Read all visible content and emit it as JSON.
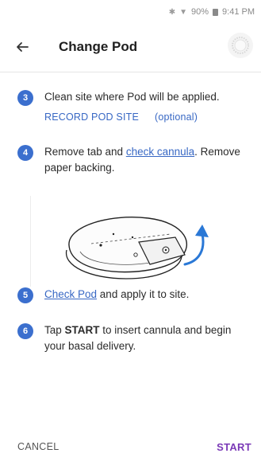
{
  "status_bar": {
    "battery": "90%",
    "time": "9:41 PM",
    "icons": [
      "bluetooth-icon",
      "wifi-icon",
      "battery-icon"
    ]
  },
  "header": {
    "title": "Change Pod",
    "back_icon": "arrow-left-icon",
    "status_icon": "pod-status-icon"
  },
  "steps": [
    {
      "number": "3",
      "text": "Clean site where Pod will be applied.",
      "record_label": "RECORD POD SITE",
      "optional_label": "(optional)"
    },
    {
      "number": "4",
      "pre": "Remove tab and ",
      "link": "check cannula",
      "post": ". Remove paper backing."
    },
    {
      "number": "5",
      "link": "Check Pod",
      "post": " and apply it to site."
    },
    {
      "number": "6",
      "pre": "Tap ",
      "bold": "START",
      "post": " to insert cannula and begin your basal delivery."
    }
  ],
  "illustration": "pod-tab-removal-illustration",
  "footer": {
    "cancel_label": "CANCEL",
    "start_label": "START"
  },
  "colors": {
    "accent_blue": "#3b6fce",
    "link_blue": "#3868c4",
    "start_purple": "#7b3ab7",
    "arrow_blue": "#2a78d6"
  }
}
